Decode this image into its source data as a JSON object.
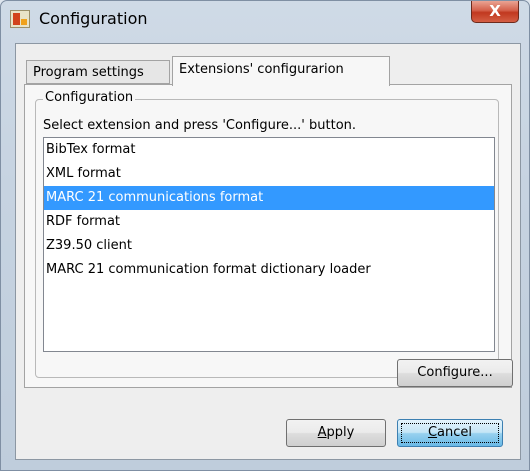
{
  "window": {
    "title": "Configuration",
    "close_label": "X"
  },
  "tabs": [
    {
      "label": "Program settings",
      "selected": false
    },
    {
      "label": "Extensions' configurarion",
      "selected": true
    }
  ],
  "group": {
    "legend": "Configuration",
    "instructions": "Select extension and press 'Configure...' button."
  },
  "extensions": {
    "items": [
      {
        "label": "BibTex format"
      },
      {
        "label": "XML format"
      },
      {
        "label": "MARC 21 communications format"
      },
      {
        "label": "RDF format"
      },
      {
        "label": "Z39.50 client"
      },
      {
        "label": "MARC 21 communication format dictionary loader"
      }
    ],
    "selected_label": "MARC 21 communications format"
  },
  "buttons": {
    "configure": "Configure...",
    "apply_first": "A",
    "apply_rest": "pply",
    "cancel_first": "C",
    "cancel_rest": "ancel"
  },
  "colors": {
    "selection": "#3399ff",
    "close_button": "#c1381f"
  },
  "icons": {
    "app_icon": "app-logo-icon"
  }
}
